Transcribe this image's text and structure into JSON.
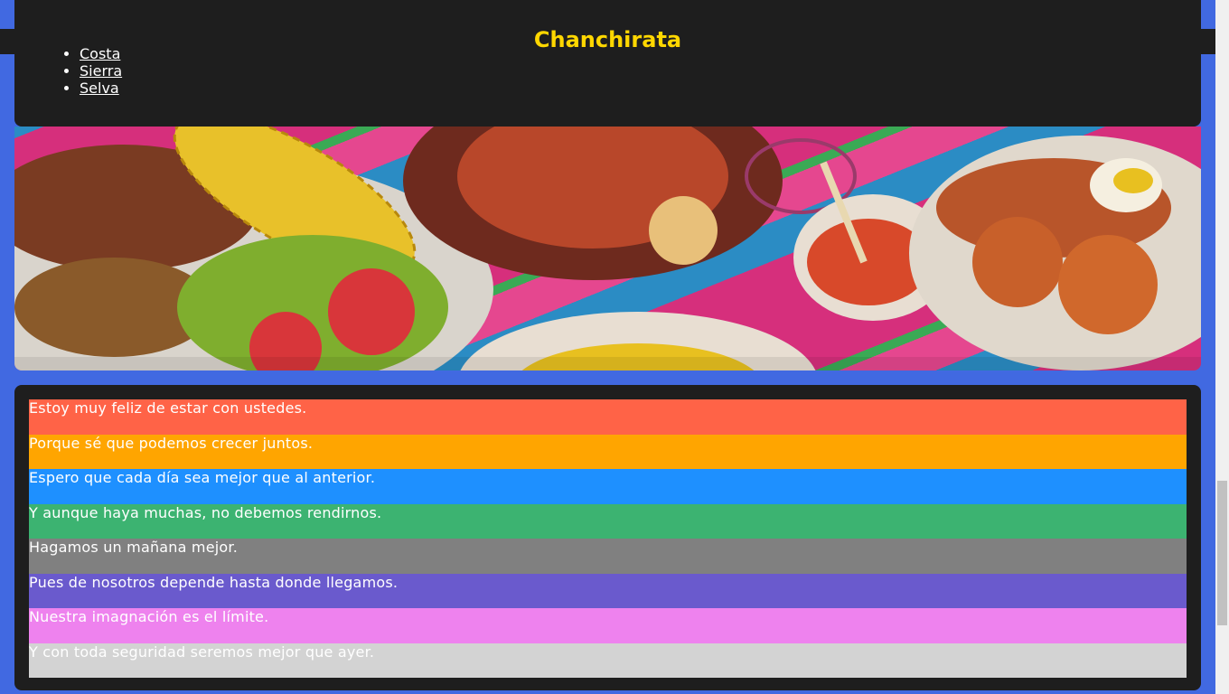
{
  "header": {
    "title": "Chanchirata",
    "regions": [
      "Costa",
      "Sierra",
      "Selva"
    ]
  },
  "hero": {
    "image": "peruvian-food-illustration"
  },
  "messages": [
    {
      "text": "Estoy muy feliz de estar con ustedes.",
      "color": "#ff6347"
    },
    {
      "text": "Porque sé que podemos crecer juntos.",
      "color": "#ffa500"
    },
    {
      "text": "Espero que cada día sea mejor que al anterior.",
      "color": "#1e90ff"
    },
    {
      "text": "Y aunque haya muchas, no debemos rendirnos.",
      "color": "#3cb371"
    },
    {
      "text": "Hagamos un mañana mejor.",
      "color": "#808080"
    },
    {
      "text": "Pues de nosotros depende hasta donde llegamos.",
      "color": "#6a5acd"
    },
    {
      "text": "Nuestra imagnación es el límite.",
      "color": "#ee82ee"
    },
    {
      "text": "Y con toda seguridad seremos mejor que ayer.",
      "color": "#d3d3d3"
    }
  ],
  "colors": {
    "background": "#4169e1",
    "card": "#1e1e1e",
    "title": "#ffd700"
  }
}
